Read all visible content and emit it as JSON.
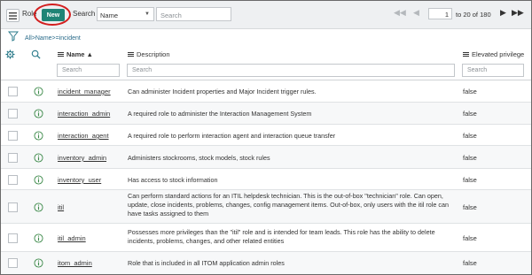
{
  "header": {
    "list_title": "Role",
    "new_label": "New",
    "search_label": "Search",
    "field_select_value": "Name",
    "search_placeholder": "Search",
    "page_value": "1",
    "page_range": "to 20 of 180"
  },
  "breadcrumb": "All>Name>=incident",
  "columns": {
    "name": "Name ▲",
    "description": "Description",
    "elevated": "Elevated privilege"
  },
  "filters": {
    "name_placeholder": "Search",
    "description_placeholder": "Search",
    "elevated_placeholder": "Search"
  },
  "rows": [
    {
      "name": "incident_manager",
      "description": "Can administer Incident properties and Major Incident trigger rules.",
      "elevated": "false"
    },
    {
      "name": "interaction_admin",
      "description": "A required role to administer the Interaction Management System",
      "elevated": "false"
    },
    {
      "name": "interaction_agent",
      "description": "A required role to perform interaction agent and interaction queue transfer",
      "elevated": "false"
    },
    {
      "name": "inventory_admin",
      "description": "Administers stockrooms, stock models, stock rules",
      "elevated": "false"
    },
    {
      "name": "inventory_user",
      "description": "Has access to stock information",
      "elevated": "false"
    },
    {
      "name": "itil",
      "description": "Can perform standard actions for an ITIL helpdesk technician. This is the out-of-box \"technician\" role. Can open, update, close incidents, problems, changes, config management items. Out-of-box, only users with the itil role can have tasks assigned to them",
      "elevated": "false"
    },
    {
      "name": "itil_admin",
      "description": "Possesses more privileges than the \"itil\" role and is intended for team leads. This role has the ability to delete incidents, problems, changes, and other related entities",
      "elevated": "false"
    },
    {
      "name": "itom_admin",
      "description": "Role that is included in all ITOM application admin roles",
      "elevated": "false"
    }
  ],
  "colors": {
    "new_button": "#1f8476",
    "highlight_oval": "#d21e1e",
    "info_icon": "#3d8a4a",
    "header_bg": "#eef0f2"
  },
  "icons": [
    "hamburger-menu-icon",
    "filter-funnel-icon",
    "gear-icon",
    "search-icon",
    "info-circle-icon",
    "first-page-icon",
    "previous-page-icon",
    "next-page-icon",
    "last-page-icon"
  ]
}
